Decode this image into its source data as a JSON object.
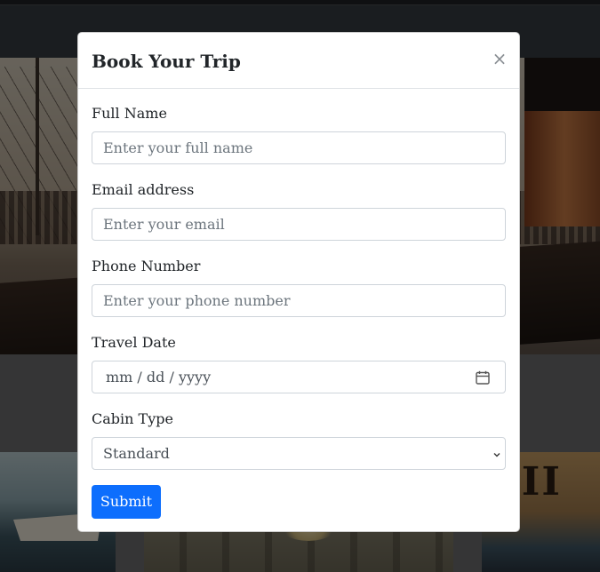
{
  "modal": {
    "title": "Book Your Trip",
    "close_symbol": "×",
    "fields": {
      "full_name": {
        "label": "Full Name",
        "placeholder": "Enter your full name"
      },
      "email": {
        "label": "Email address",
        "placeholder": "Enter your email"
      },
      "phone": {
        "label": "Phone Number",
        "placeholder": "Enter your phone number"
      },
      "travel_date": {
        "label": "Travel Date",
        "placeholder": "mm / dd / yyyy",
        "icon": "calendar-icon"
      },
      "cabin_type": {
        "label": "Cabin Type",
        "selected": "Standard",
        "icon": "chevron-down-icon"
      }
    },
    "submit_label": "Submit"
  },
  "background": {
    "card_3_text": "TII"
  },
  "colors": {
    "primary": "#0d6efd",
    "navbar": "#343a40",
    "backdrop": "rgba(0,0,0,0.5)"
  }
}
